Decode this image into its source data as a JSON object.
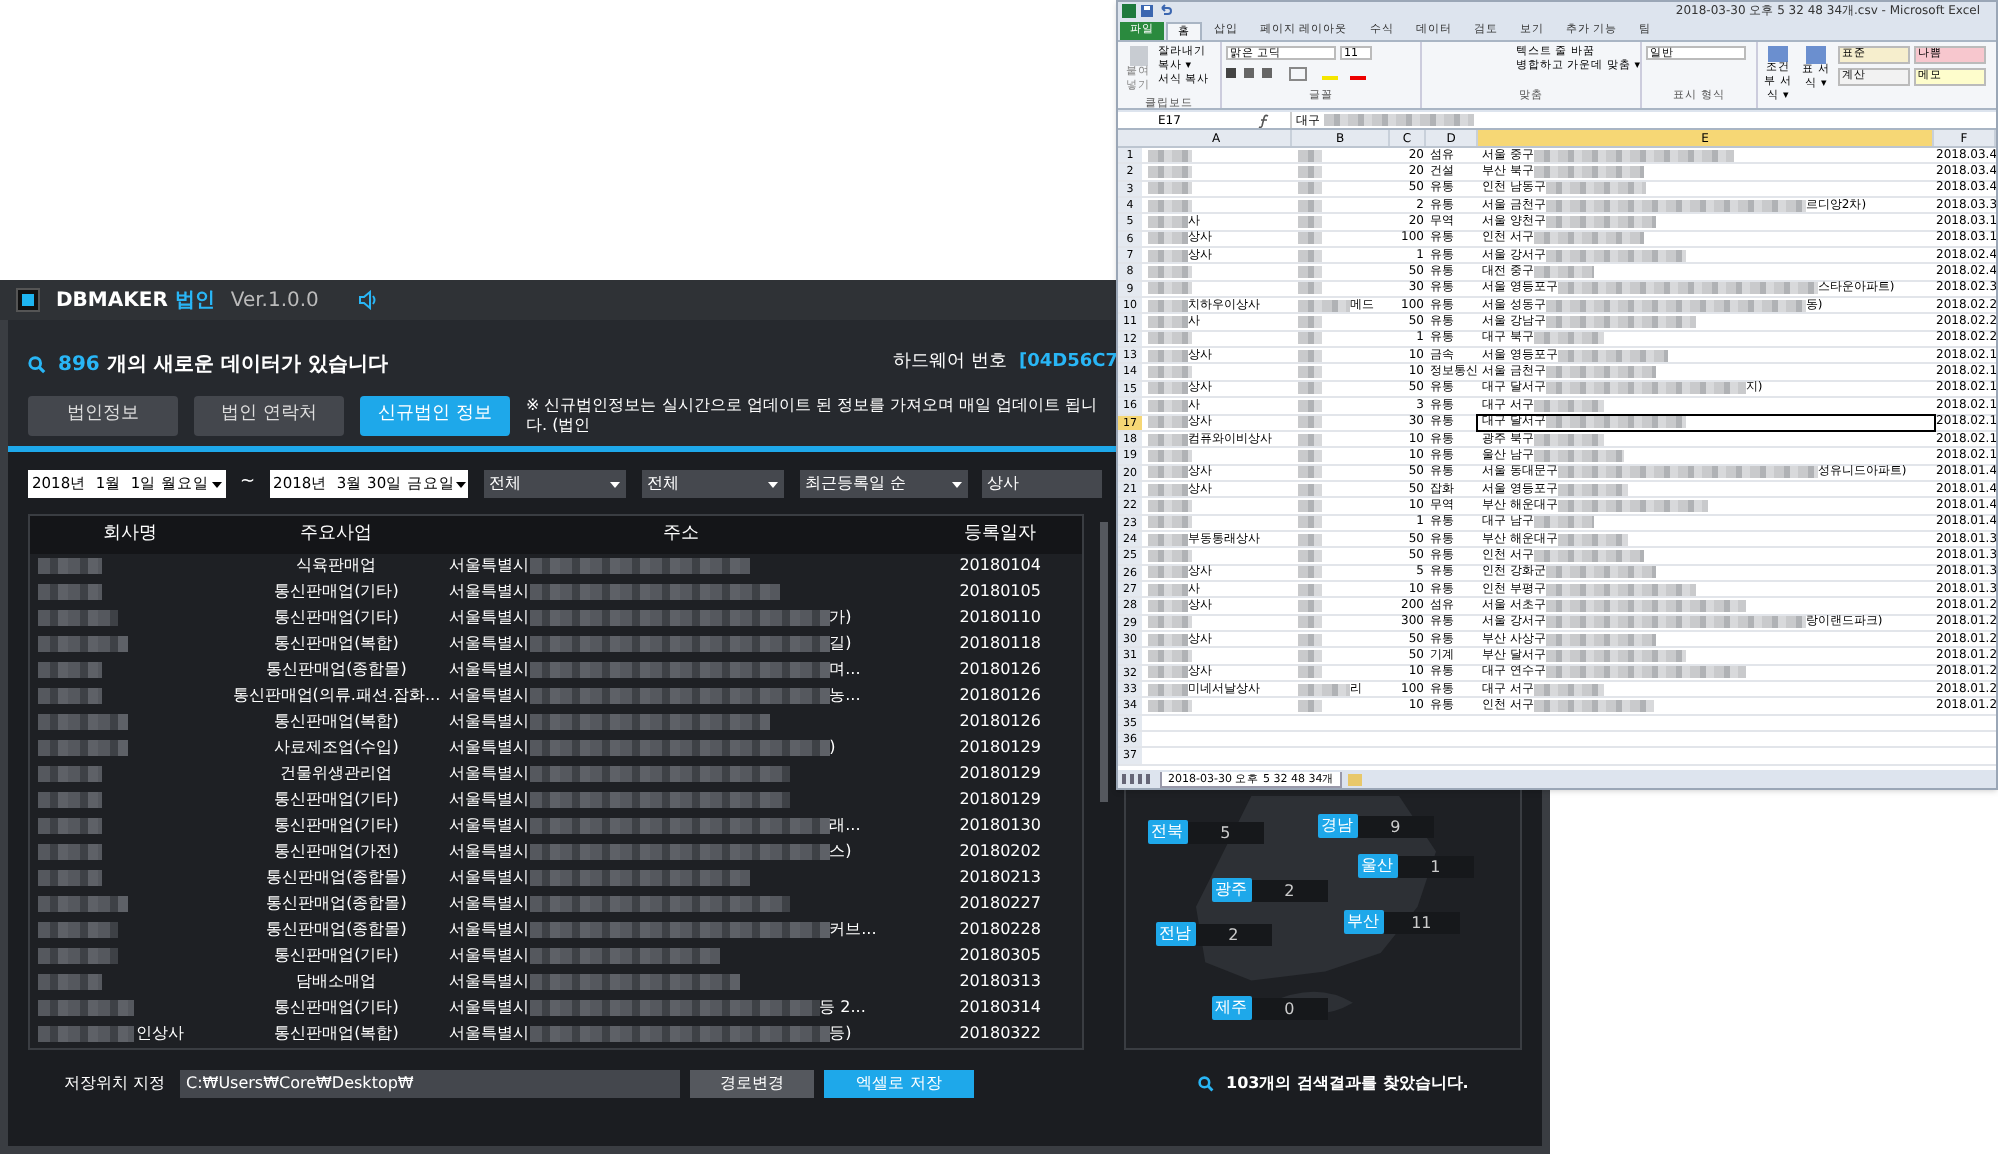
{
  "app": {
    "brand": "DBMAKER",
    "brand_suffix": "법인",
    "version": "Ver.1.0.0",
    "new_data": {
      "count": "896",
      "text": "개의 새로운 데이터가 있습니다"
    },
    "hardware": {
      "label": "하드웨어 번호",
      "value": "[04D56C7"
    },
    "tabs": [
      {
        "label": "법인정보",
        "selected": false
      },
      {
        "label": "법인 연락처",
        "selected": false
      },
      {
        "label": "신규법인 정보",
        "selected": true
      }
    ],
    "notice": "※ 신규법인정보는 실시간으로 업데이트 된 정보를 가져오며 매일 업데이트 됩니다. (법인",
    "filters": {
      "date_from": "2018년  1월  1일 월요일",
      "separator": "~",
      "date_to": "2018년  3월 30일 금요일",
      "dropdowns": [
        "전체",
        "전체",
        "최근등록일 순"
      ],
      "keyword": "상사"
    },
    "table": {
      "columns": [
        "회사명",
        "주요사업",
        "주소",
        "등록일자"
      ],
      "rows": [
        {
          "business": "식육판매업",
          "address": "서울특별시",
          "date": "20180104"
        },
        {
          "business": "통신판매업(기타)",
          "address": "서울특별시",
          "date": "20180105"
        },
        {
          "business": "통신판매업(기타)",
          "address": "서울특별시",
          "address_end": "가)",
          "date": "20180110"
        },
        {
          "business": "통신판매업(복합)",
          "address": "서울특별시",
          "address_end": "길)",
          "date": "20180118"
        },
        {
          "business": "통신판매업(종합몰)",
          "address": "서울특별시",
          "address_end": "며...",
          "date": "20180126"
        },
        {
          "business": "통신판매업(의류.패션.잡화...",
          "address": "서울특별시",
          "address_end": "농...",
          "date": "20180126"
        },
        {
          "business": "통신판매업(복합)",
          "address": "서울특별시",
          "date": "20180126"
        },
        {
          "business": "사료제조업(수입)",
          "address": "서울특별시",
          "address_end": ")",
          "date": "20180129"
        },
        {
          "business": "건물위생관리업",
          "address": "서울특별시",
          "date": "20180129"
        },
        {
          "business": "통신판매업(기타)",
          "address": "서울특별시",
          "date": "20180129"
        },
        {
          "business": "통신판매업(기타)",
          "address": "서울특별시",
          "address_end": "래...",
          "date": "20180130"
        },
        {
          "business": "통신판매업(가전)",
          "address": "서울특별시",
          "address_end": "스)",
          "date": "20180202"
        },
        {
          "business": "통신판매업(종합몰)",
          "address": "서울특별시",
          "date": "20180213"
        },
        {
          "business": "통신판매업(종합몰)",
          "address": "서울특별시",
          "date": "20180227"
        },
        {
          "business": "통신판매업(종합몰)",
          "address": "서울특별시",
          "address_end": "커브...",
          "date": "20180228"
        },
        {
          "business": "통신판매업(기타)",
          "address": "서울특별시",
          "date": "20180305"
        },
        {
          "business": "담배소매업",
          "address": "서울특별시",
          "date": "20180313"
        },
        {
          "business": "통신판매업(기타)",
          "address": "서울특별시",
          "address_end": "등 2...",
          "date": "20180314"
        },
        {
          "company": "인상사",
          "business": "통신판매업(복합)",
          "address": "서울특별시",
          "address_end": "등)",
          "date": "20180322"
        }
      ]
    },
    "map": {
      "regions": [
        {
          "name": "전북",
          "count": "5"
        },
        {
          "name": "경남",
          "count": "9"
        },
        {
          "name": "울산",
          "count": "1"
        },
        {
          "name": "광주",
          "count": "2"
        },
        {
          "name": "부산",
          "count": "11"
        },
        {
          "name": "전남",
          "count": "2"
        },
        {
          "name": "제주",
          "count": "0"
        }
      ]
    },
    "result_message": "103개의 검색결과를 찾았습니다.",
    "save": {
      "label": "저장위치 지정",
      "path": "C:₩Users₩Core₩Desktop₩",
      "buttons": [
        "경로변경",
        "엑셀로 저장"
      ]
    }
  },
  "excel": {
    "title": "2018-03-30 오후 5 32 48 34개.csv - Microsoft Excel",
    "tabs": [
      {
        "label": "파일",
        "kind": "file",
        "selected": false
      },
      {
        "label": "홈",
        "kind": "tab",
        "selected": true
      },
      {
        "label": "삽입",
        "kind": "tab",
        "selected": false
      },
      {
        "label": "페이지 레이아웃",
        "kind": "tab",
        "selected": false
      },
      {
        "label": "수식",
        "kind": "tab",
        "selected": false
      },
      {
        "label": "데이터",
        "kind": "tab",
        "selected": false
      },
      {
        "label": "검토",
        "kind": "tab",
        "selected": false
      },
      {
        "label": "보기",
        "kind": "tab",
        "selected": false
      },
      {
        "label": "추가 기능",
        "kind": "tab",
        "selected": false
      },
      {
        "label": "팀",
        "kind": "tab",
        "selected": false
      }
    ],
    "clipboard": {
      "paste": "붙여넣기",
      "items": [
        "잘라내기",
        "복사 ▾",
        "서식 복사"
      ],
      "group": "클립보드"
    },
    "font": {
      "name": "맑은 고딕",
      "size": "11",
      "group": "글꼴"
    },
    "alignment": {
      "wrap": "텍스트 줄 바꿈",
      "merge": "병합하고 가운데 맞춤 ▾",
      "group": "맞춤"
    },
    "number": {
      "format": "일반",
      "group": "표시 형식"
    },
    "styles": {
      "buttons": [
        "조건부 서식 ▾",
        "표 서식 ▾"
      ],
      "cells": [
        {
          "label": "표준",
          "color": "#f6eecd"
        },
        {
          "label": "나쁨",
          "color": "#f7c7ce"
        },
        {
          "label": "계산",
          "color": "#f2f2f2"
        },
        {
          "label": "메모",
          "color": "#fefdcc"
        }
      ]
    },
    "name_box": "E17",
    "formula": "대구",
    "columns": [
      {
        "label": "A",
        "selected": false
      },
      {
        "label": "B",
        "selected": false
      },
      {
        "label": "C",
        "selected": false
      },
      {
        "label": "D",
        "selected": false
      },
      {
        "label": "E",
        "selected": true
      },
      {
        "label": "F",
        "selected": false
      }
    ],
    "rows": [
      {
        "num": "1",
        "c": "20",
        "d": "섬유",
        "e": "서울 중구",
        "f": "2018.03.4",
        "selected": false
      },
      {
        "num": "2",
        "c": "20",
        "d": "건설",
        "e": "부산 북구",
        "f": "2018.03.4",
        "selected": false
      },
      {
        "num": "3",
        "c": "50",
        "d": "유통",
        "e": "인천 남동구",
        "f": "2018.03.4",
        "selected": false
      },
      {
        "num": "4",
        "c": "2",
        "d": "유통",
        "e": "서울 금천구",
        "e_end": "르디앙2차)",
        "f": "2018.03.3",
        "selected": false
      },
      {
        "num": "5",
        "a": "사",
        "c": "20",
        "d": "무역",
        "e": "서울 양천구",
        "f": "2018.03.1",
        "selected": false
      },
      {
        "num": "6",
        "a": "상사",
        "c": "100",
        "d": "유통",
        "e": "인천 서구",
        "f": "2018.03.1",
        "selected": false
      },
      {
        "num": "7",
        "a": "상사",
        "c": "1",
        "d": "유통",
        "e": "서울 강서구",
        "f": "2018.02.4",
        "selected": false
      },
      {
        "num": "8",
        "c": "50",
        "d": "유통",
        "e": "대전 중구",
        "f": "2018.02.4",
        "selected": false
      },
      {
        "num": "9",
        "c": "30",
        "d": "유통",
        "e": "서울 영등포구",
        "e_end": "스타운아파트)",
        "f": "2018.02.3",
        "selected": false
      },
      {
        "num": "10",
        "a": "치하우이상사",
        "b": "메드",
        "c": "100",
        "d": "유통",
        "e": "서울 성동구",
        "e_end": "동)",
        "f": "2018.02.2",
        "selected": false
      },
      {
        "num": "11",
        "a": "사",
        "c": "50",
        "d": "유통",
        "e": "서울 강남구",
        "f": "2018.02.2",
        "selected": false
      },
      {
        "num": "12",
        "c": "1",
        "d": "유통",
        "e": "대구 북구",
        "f": "2018.02.2",
        "selected": false
      },
      {
        "num": "13",
        "a": "상사",
        "c": "10",
        "d": "금속",
        "e": "서울 영등포구",
        "f": "2018.02.1",
        "selected": false
      },
      {
        "num": "14",
        "c": "10",
        "d": "정보통신",
        "e": "서울 금천구",
        "f": "2018.02.1",
        "selected": false
      },
      {
        "num": "15",
        "a": "상사",
        "c": "50",
        "d": "유통",
        "e": "대구 달서구",
        "e_end": "지)",
        "f": "2018.02.1",
        "selected": false
      },
      {
        "num": "16",
        "a": "사",
        "c": "3",
        "d": "유통",
        "e": "대구 서구",
        "f": "2018.02.1",
        "selected": false
      },
      {
        "num": "17",
        "a": "상사",
        "c": "30",
        "d": "유통",
        "e": "대구 달서구",
        "f": "2018.02.1",
        "selected": true
      },
      {
        "num": "18",
        "a": "컴퓨와이비상사",
        "c": "10",
        "d": "유통",
        "e": "광주 북구",
        "f": "2018.02.1",
        "selected": false
      },
      {
        "num": "19",
        "c": "10",
        "d": "유통",
        "e": "울산 남구",
        "f": "2018.02.1",
        "selected": false
      },
      {
        "num": "20",
        "a": "상사",
        "c": "50",
        "d": "유통",
        "e": "서울 동대문구",
        "e_end": "성유니드아파트)",
        "f": "2018.01.4",
        "selected": false
      },
      {
        "num": "21",
        "a": "상사",
        "c": "50",
        "d": "잡화",
        "e": "서울 영등포구",
        "f": "2018.01.4",
        "selected": false
      },
      {
        "num": "22",
        "c": "10",
        "d": "무역",
        "e": "부산 해운대구",
        "f": "2018.01.4",
        "selected": false
      },
      {
        "num": "23",
        "c": "1",
        "d": "유통",
        "e": "대구 남구",
        "f": "2018.01.4",
        "selected": false
      },
      {
        "num": "24",
        "a": "부동통래상사",
        "c": "50",
        "d": "유통",
        "e": "부산 해운대구",
        "f": "2018.01.3",
        "selected": false
      },
      {
        "num": "25",
        "c": "50",
        "d": "유통",
        "e": "인천 서구",
        "f": "2018.01.3",
        "selected": false
      },
      {
        "num": "26",
        "a": "상사",
        "c": "5",
        "d": "유통",
        "e": "인천 강화군",
        "f": "2018.01.3",
        "selected": false
      },
      {
        "num": "27",
        "a": "사",
        "c": "10",
        "d": "유통",
        "e": "인천 부평구",
        "f": "2018.01.3",
        "selected": false
      },
      {
        "num": "28",
        "a": "상사",
        "c": "200",
        "d": "섬유",
        "e": "서울 서초구",
        "f": "2018.01.2",
        "selected": false
      },
      {
        "num": "29",
        "c": "300",
        "d": "유통",
        "e": "서울 강서구",
        "e_end": "랑이랜드파크)",
        "f": "2018.01.2",
        "selected": false
      },
      {
        "num": "30",
        "a": "상사",
        "c": "50",
        "d": "유통",
        "e": "부산 사상구",
        "f": "2018.01.2",
        "selected": false
      },
      {
        "num": "31",
        "c": "50",
        "d": "기계",
        "e": "부산 달서구",
        "f": "2018.01.2",
        "selected": false
      },
      {
        "num": "32",
        "a": "상사",
        "c": "10",
        "d": "유통",
        "e": "대구 연수구",
        "f": "2018.01.2",
        "selected": false
      },
      {
        "num": "33",
        "a": "미네서날상사",
        "b": "리",
        "c": "100",
        "d": "유통",
        "e": "대구 서구",
        "f": "2018.01.2",
        "selected": false
      },
      {
        "num": "34",
        "c": "10",
        "d": "유통",
        "e": "인천 서구",
        "f": "2018.01.2",
        "selected": false
      },
      {
        "num": "35",
        "selected": false
      },
      {
        "num": "36",
        "selected": false
      },
      {
        "num": "37",
        "selected": false
      }
    ],
    "sheet_tab": "2018-03-30 오후 5 32 48 34개"
  }
}
